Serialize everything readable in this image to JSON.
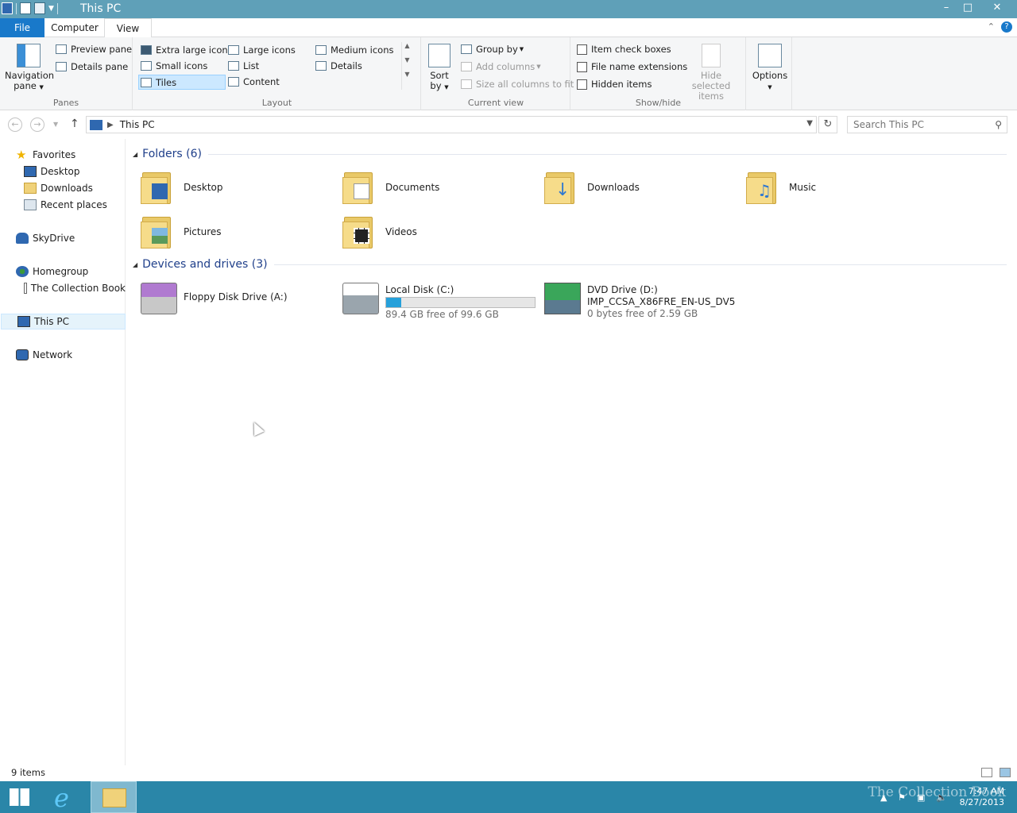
{
  "window": {
    "title": "This PC",
    "minimize_label": "–",
    "maximize_label": "□",
    "close_label": "✕"
  },
  "ribbon": {
    "tabs": {
      "file": "File",
      "computer": "Computer",
      "view": "View"
    },
    "panes": {
      "group_label": "Panes",
      "navigation_pane": "Navigation pane",
      "preview_pane": "Preview pane",
      "details_pane": "Details pane"
    },
    "layout": {
      "group_label": "Layout",
      "extra_large_icons": "Extra large icons",
      "large_icons": "Large icons",
      "medium_icons": "Medium icons",
      "small_icons": "Small icons",
      "list": "List",
      "details": "Details",
      "tiles": "Tiles",
      "content": "Content"
    },
    "current_view": {
      "group_label": "Current view",
      "sort_by": "Sort by",
      "group_by": "Group by",
      "add_columns": "Add columns",
      "size_all_columns": "Size all columns to fit"
    },
    "show_hide": {
      "group_label": "Show/hide",
      "item_check_boxes": "Item check boxes",
      "file_name_extensions": "File name extensions",
      "hidden_items": "Hidden items",
      "hide_selected_items": "Hide selected items"
    },
    "options": "Options"
  },
  "address": {
    "path": "This PC",
    "search_placeholder": "Search This PC"
  },
  "nav_pane": {
    "favorites": "Favorites",
    "desktop": "Desktop",
    "downloads": "Downloads",
    "recent_places": "Recent places",
    "skydrive": "SkyDrive",
    "homegroup": "Homegroup",
    "collection_book": "The Collection Book",
    "this_pc": "This PC",
    "network": "Network"
  },
  "folders": {
    "header": "Folders (6)",
    "items": [
      {
        "name": "Desktop"
      },
      {
        "name": "Documents"
      },
      {
        "name": "Downloads"
      },
      {
        "name": "Music"
      },
      {
        "name": "Pictures"
      },
      {
        "name": "Videos"
      }
    ]
  },
  "drives": {
    "header": "Devices and drives (3)",
    "items": [
      {
        "name": "Floppy Disk Drive (A:)"
      },
      {
        "name": "Local Disk (C:)",
        "free": "89.4 GB free of 99.6 GB",
        "used_fraction": 0.1
      },
      {
        "name": "DVD Drive (D:)",
        "label": "IMP_CCSA_X86FRE_EN-US_DV5",
        "free": "0 bytes free of 2.59 GB"
      }
    ]
  },
  "status": {
    "count": "9 items"
  },
  "taskbar": {
    "time": "7:47 AM",
    "date": "8/27/2013",
    "watermark": "The Collection Book"
  },
  "colors": {
    "titlebar": "#5fa0b8",
    "file_tab": "#1979ca",
    "taskbar": "#2a86a8",
    "progress": "#26a0da"
  }
}
